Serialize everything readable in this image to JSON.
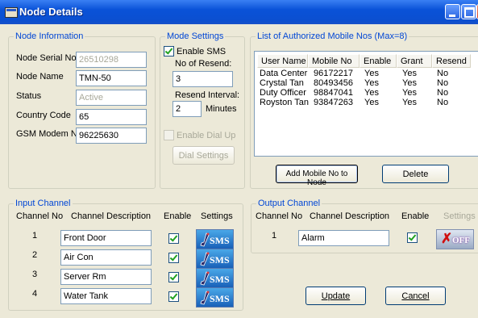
{
  "window": {
    "title": "Node Details"
  },
  "node_info": {
    "legend": "Node Information",
    "serial_label": "Node Serial No",
    "serial_value": "26510298",
    "name_label": "Node Name",
    "name_value": "TMN-50",
    "status_label": "Status",
    "status_value": "Active",
    "country_label": "Country Code",
    "country_value": "65",
    "gsm_label": "GSM Modem No",
    "gsm_value": "96225630"
  },
  "mode_settings": {
    "legend": "Mode Settings",
    "enable_sms_label": "Enable SMS",
    "enable_sms_checked": true,
    "resend_label": "No of Resend:",
    "resend_value": "3",
    "interval_label": "Resend Interval:",
    "interval_value": "2",
    "interval_unit": "Minutes",
    "dialup_label": "Enable Dial Up",
    "dialup_checked": false,
    "dial_settings_label": "Dial Settings"
  },
  "mobile_list": {
    "legend": "List of Authorized Mobile Nos (Max=8)",
    "columns": [
      "User Name",
      "Mobile No",
      "Enable",
      "Grant",
      "Resend"
    ],
    "rows": [
      [
        "Data Center",
        "96172217",
        "Yes",
        "Yes",
        "No"
      ],
      [
        "Crystal Tan",
        "80493456",
        "Yes",
        "Yes",
        "No"
      ],
      [
        "Duty Officer",
        "98847041",
        "Yes",
        "Yes",
        "No"
      ],
      [
        "Royston Tan",
        "93847263",
        "Yes",
        "Yes",
        "No"
      ]
    ],
    "add_label": "Add Mobile No to Node",
    "delete_label": "Delete"
  },
  "input_channel": {
    "legend": "Input Channel",
    "col_no": "Channel No",
    "col_desc": "Channel Description",
    "col_enable": "Enable",
    "col_settings": "Settings",
    "channels": [
      {
        "no": "1",
        "desc": "Front Door",
        "enabled": true,
        "settings_text": "SMS"
      },
      {
        "no": "2",
        "desc": "Air Con",
        "enabled": true,
        "settings_text": "SMS"
      },
      {
        "no": "3",
        "desc": "Server Rm",
        "enabled": true,
        "settings_text": "SMS"
      },
      {
        "no": "4",
        "desc": "Water Tank",
        "enabled": true,
        "settings_text": "SMS"
      }
    ]
  },
  "output_channel": {
    "legend": "Output Channel",
    "col_no": "Channel No",
    "col_desc": "Channel Description",
    "col_enable": "Enable",
    "col_settings": "Settings",
    "channels": [
      {
        "no": "1",
        "desc": "Alarm",
        "enabled": true,
        "settings_text": "OFF"
      }
    ]
  },
  "footer": {
    "update_label": "Update",
    "cancel_label": "Cancel"
  },
  "colors": {
    "title_bar": "#0b4fd0",
    "group_legend": "#0046d5",
    "dialog_bg": "#ece9d8",
    "sms_button": "#1860b8"
  }
}
